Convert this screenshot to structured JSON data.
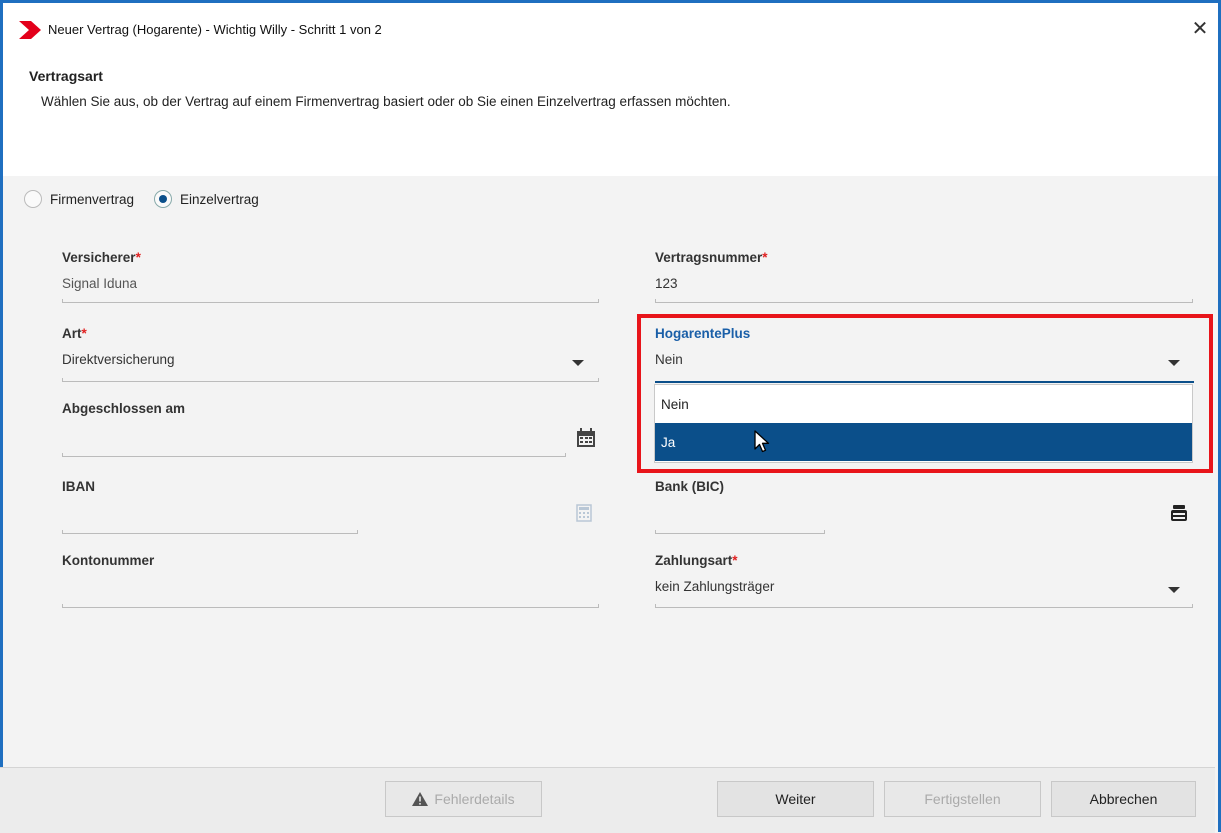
{
  "window": {
    "title": "Neuer Vertrag (Hogarente) - Wichtig Willy - Schritt 1 von 2",
    "close": "✕"
  },
  "header": {
    "title": "Vertragsart",
    "subtitle": "Wählen Sie aus, ob der Vertrag auf einem Firmenvertrag basiert oder ob Sie einen Einzelvertrag erfassen möchten."
  },
  "radios": {
    "firmen": "Firmenvertrag",
    "einzel": "Einzelvertrag",
    "selected": "einzel"
  },
  "fields": {
    "versicherer": {
      "label": "Versicherer",
      "value": "Signal Iduna"
    },
    "vertragsnummer": {
      "label": "Vertragsnummer",
      "value": "123"
    },
    "art": {
      "label": "Art",
      "value": "Direktversicherung"
    },
    "hogarente": {
      "label": "HogarentePlus",
      "value": "Nein"
    },
    "abgeschlossen": {
      "label": "Abgeschlossen am",
      "value": ""
    },
    "iban": {
      "label": "IBAN",
      "value": ""
    },
    "bank": {
      "label": "Bank (BIC)",
      "value": ""
    },
    "kontonummer": {
      "label": "Kontonummer",
      "value": ""
    },
    "zahlungsart": {
      "label": "Zahlungsart",
      "value": "kein Zahlungsträger"
    }
  },
  "required_marker": "*",
  "dropdown": {
    "options": [
      "Nein",
      "Ja"
    ],
    "highlighted": "Ja"
  },
  "buttons": {
    "fehlerdetails": "Fehlerdetails",
    "weiter": "Weiter",
    "fertigstellen": "Fertigstellen",
    "abbrechen": "Abbrechen"
  },
  "colors": {
    "accent": "#0b4f8a",
    "highlight_box": "#e8141a",
    "required": "#e02020",
    "logo": "#e3001b"
  }
}
